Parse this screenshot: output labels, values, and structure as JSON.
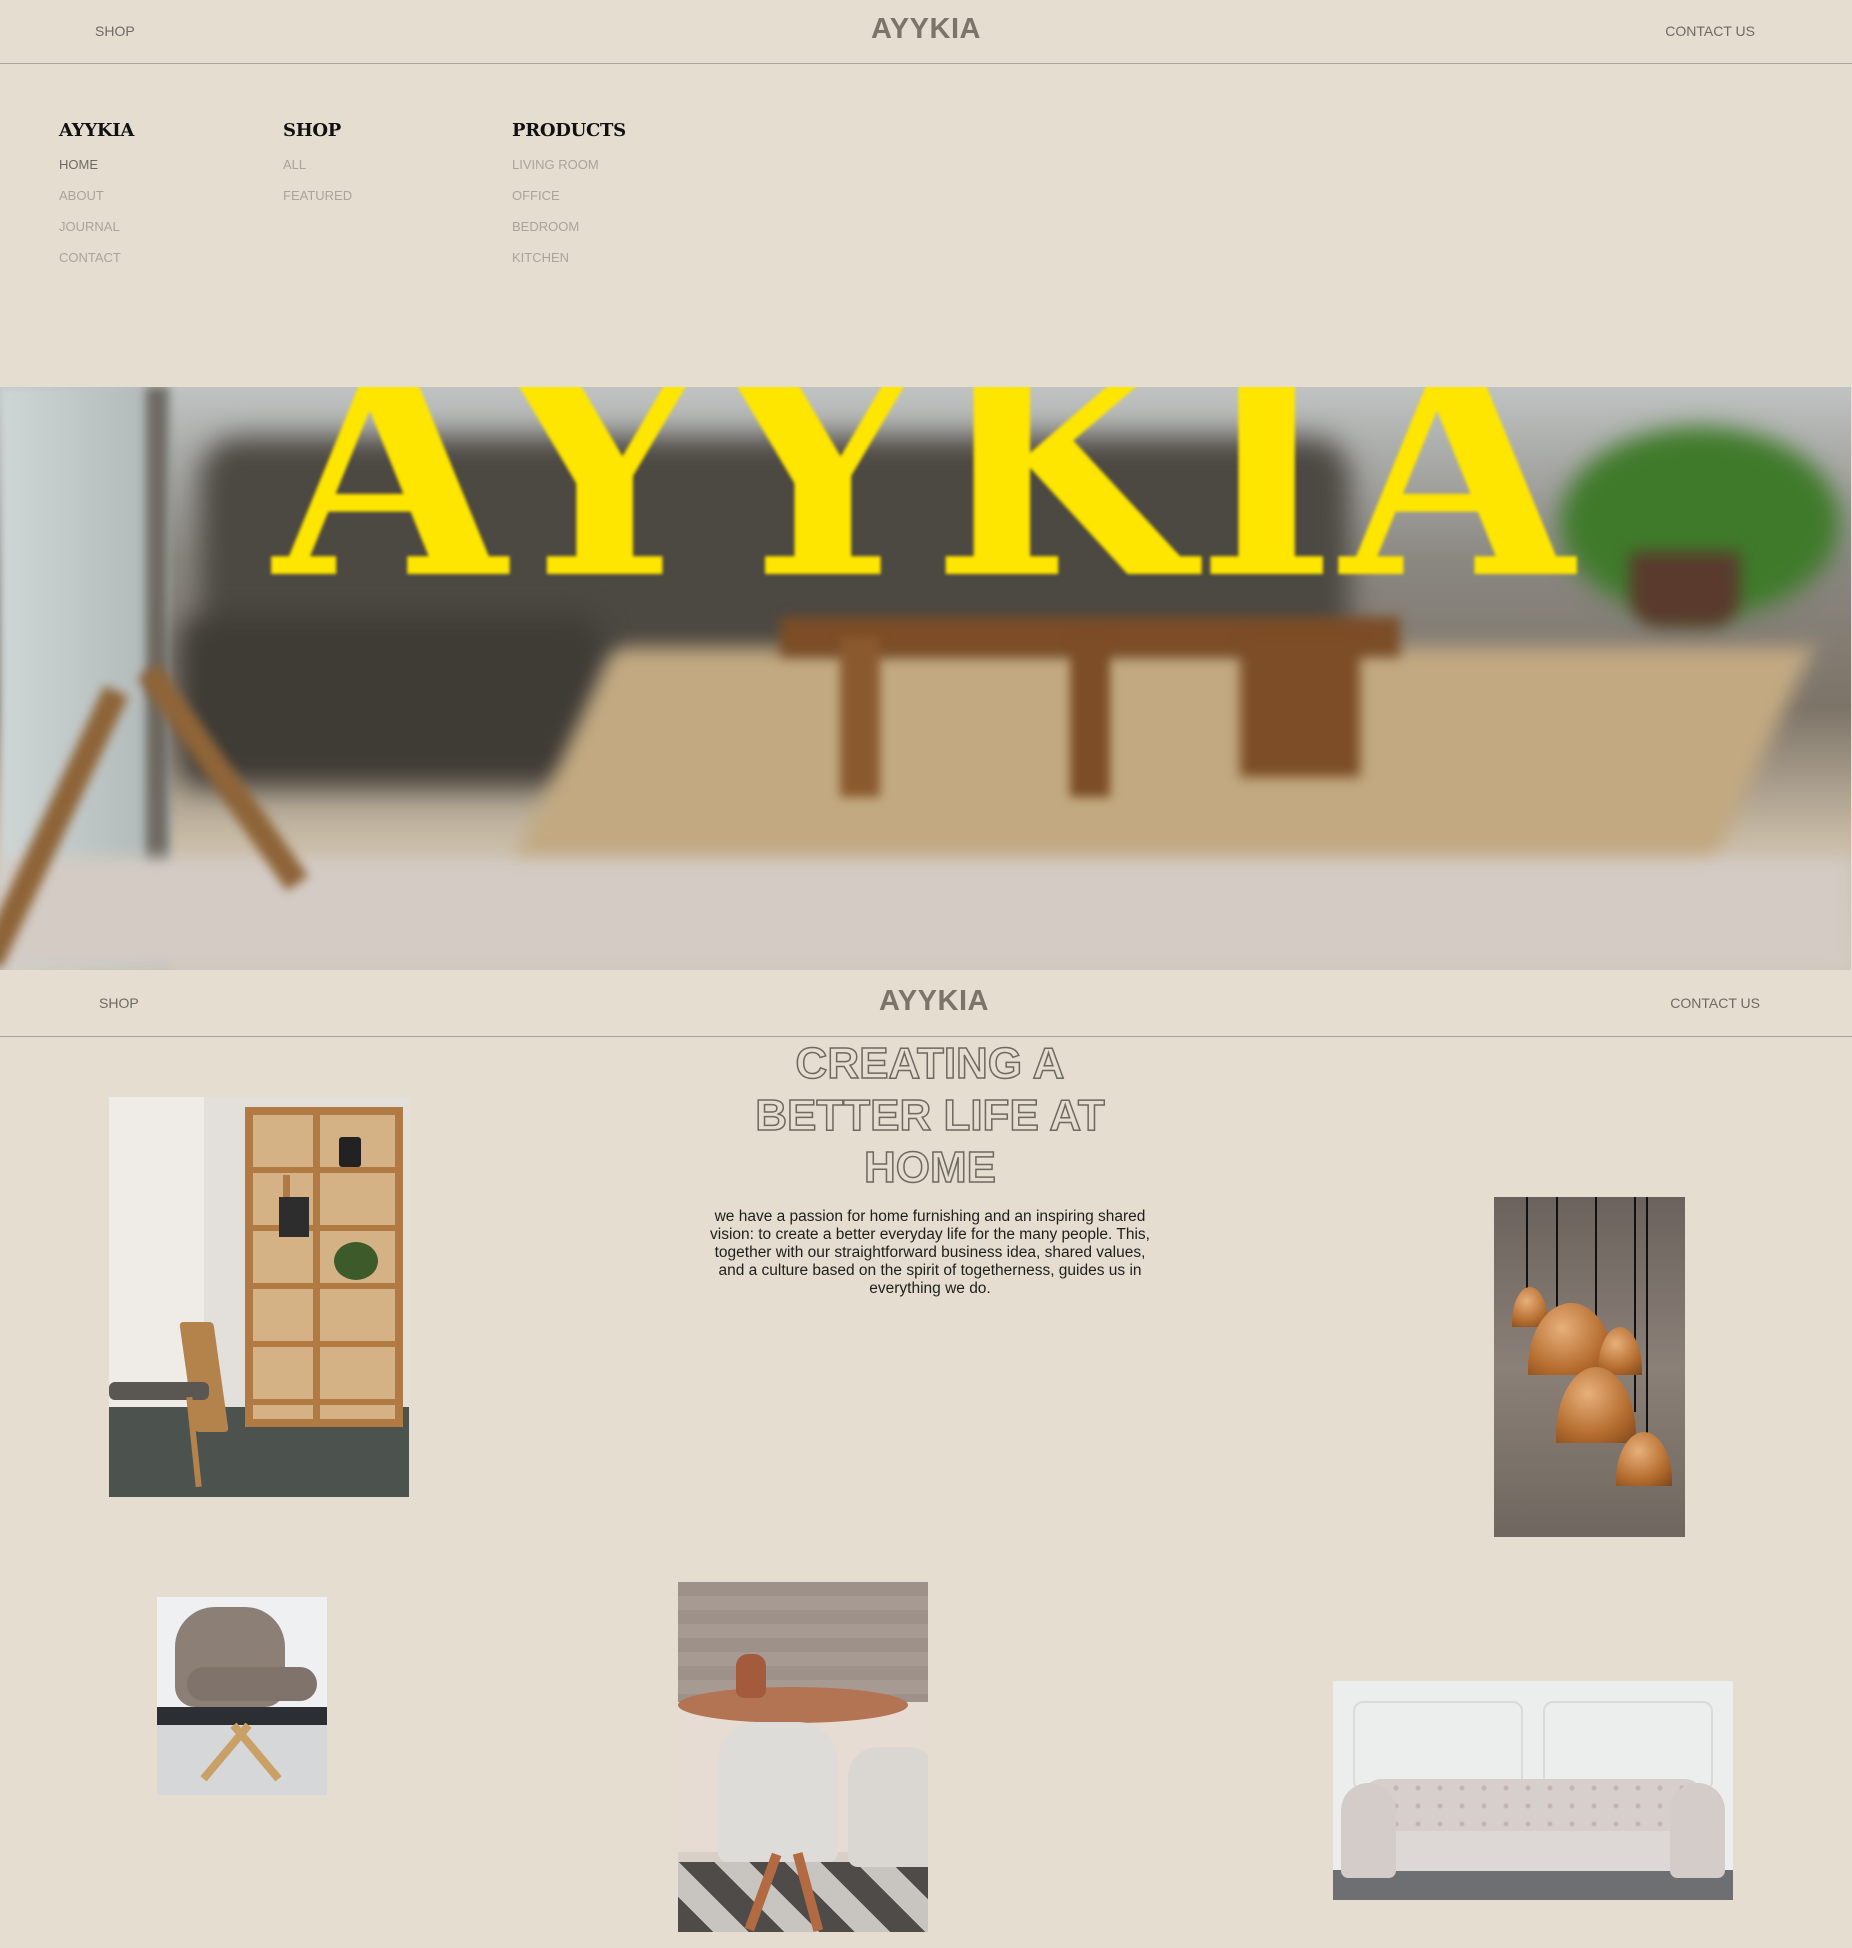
{
  "header": {
    "shop_link": "SHOP",
    "brand": "AYYKIA",
    "contact_link": "CONTACT US"
  },
  "menu": {
    "columns": [
      {
        "title": "AYYKIA",
        "items": [
          "HOME",
          "ABOUT",
          "JOURNAL",
          "CONTACT"
        ]
      },
      {
        "title": "SHOP",
        "items": [
          "ALL",
          "FEATURED"
        ]
      },
      {
        "title": "PRODUCTS",
        "items": [
          "LIVING ROOM",
          "OFFICE",
          "BEDROOM",
          "KITCHEN"
        ]
      }
    ]
  },
  "hero": {
    "title": "AYYKIA",
    "title_color": "#ffe600"
  },
  "sticky_header": {
    "shop_link": "SHOP",
    "brand": "AYYKIA",
    "contact_link": "CONTACT US"
  },
  "intro": {
    "headline_line1": "CREATING A",
    "headline_line2": "BETTER LIFE AT",
    "headline_line3": "HOME",
    "body": "we have a passion for home furnishing and an inspiring shared vision: to create a better everyday life for the many people. This, together with our straightforward business idea, shared values, and a culture based on the spirit of togetherness, guides us in everything we do."
  },
  "colors": {
    "background": "#e4ddd0",
    "text_muted": "#a9a49a",
    "brand_text": "#7a7568"
  },
  "images": {
    "shelf": "bookshelf-photo",
    "lamps": "pendant-lamps-photo",
    "chair": "lounge-chair-photo",
    "dining": "dining-table-photo",
    "sofa": "chesterfield-sofa-photo"
  }
}
